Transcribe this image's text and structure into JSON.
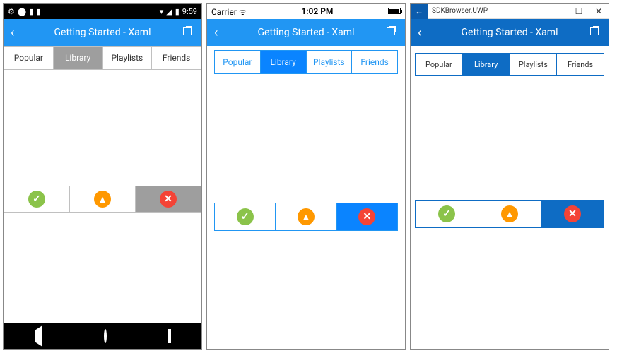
{
  "header_title": "Getting Started - Xaml",
  "tabs": [
    "Popular",
    "Library",
    "Playlists",
    "Friends"
  ],
  "selected_tab_index": 1,
  "segments": [
    "ok",
    "warn",
    "err"
  ],
  "selected_segment_index": 2,
  "status": {
    "android": {
      "time": "9:59"
    },
    "ios": {
      "carrier": "Carrier",
      "time": "1:02 PM"
    },
    "uwp": {
      "title": "SDKBrowser.UWP"
    }
  }
}
